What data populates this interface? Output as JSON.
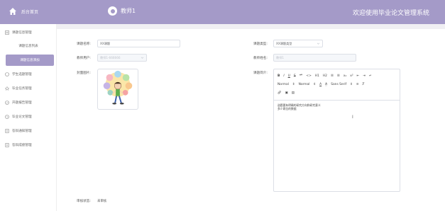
{
  "header": {
    "home_label": "后台首页",
    "user_name": "教师1",
    "system_title": "欢迎使用毕业论文管理系统"
  },
  "sidebar": {
    "items": [
      {
        "label": "课题信息管理",
        "icon": "list-icon"
      },
      {
        "label": "课题信息列表"
      },
      {
        "label": "课题信息添加"
      },
      {
        "label": "学生选题管理",
        "icon": "circle-icon"
      },
      {
        "label": "毕业任务管理",
        "icon": "star-icon"
      },
      {
        "label": "开题报告管理",
        "icon": "check-circle-icon"
      },
      {
        "label": "毕业论文管理",
        "icon": "clock-icon"
      },
      {
        "label": "答辩通知管理",
        "icon": "document-icon"
      },
      {
        "label": "答辩成绩管理",
        "icon": "document-icon"
      }
    ]
  },
  "form": {
    "topic_name_label": "课题名称:",
    "topic_name_value": "XX课题",
    "topic_type_label": "课题类型:",
    "topic_type_value": "XX课题类型",
    "teacher_user_label": "教师用户:",
    "teacher_user_value": "教师1-666666",
    "teacher_name_label": "教师姓名:",
    "teacher_name_value": "教师1",
    "cover_label": "封面图片:",
    "intro_label": "课题简介:",
    "editor_toolbar": {
      "row1": [
        "B",
        "I",
        "U",
        "S",
        "❝❞",
        "<>",
        "H1",
        "H2",
        "☰",
        "☰",
        "x₂",
        "x²",
        "⇤",
        "⇥",
        "↵"
      ],
      "normal1": "Normal",
      "normal2": "Normal",
      "font": "Sans Serif"
    },
    "editor_lines": [
      "选题要有明确的研究方向和研究意义",
      "多少两位的数据"
    ],
    "status_label": "审核状态:",
    "status_value": "未审核"
  },
  "colors": {
    "accent": "#a49ac8",
    "band": "#f0eff3"
  }
}
